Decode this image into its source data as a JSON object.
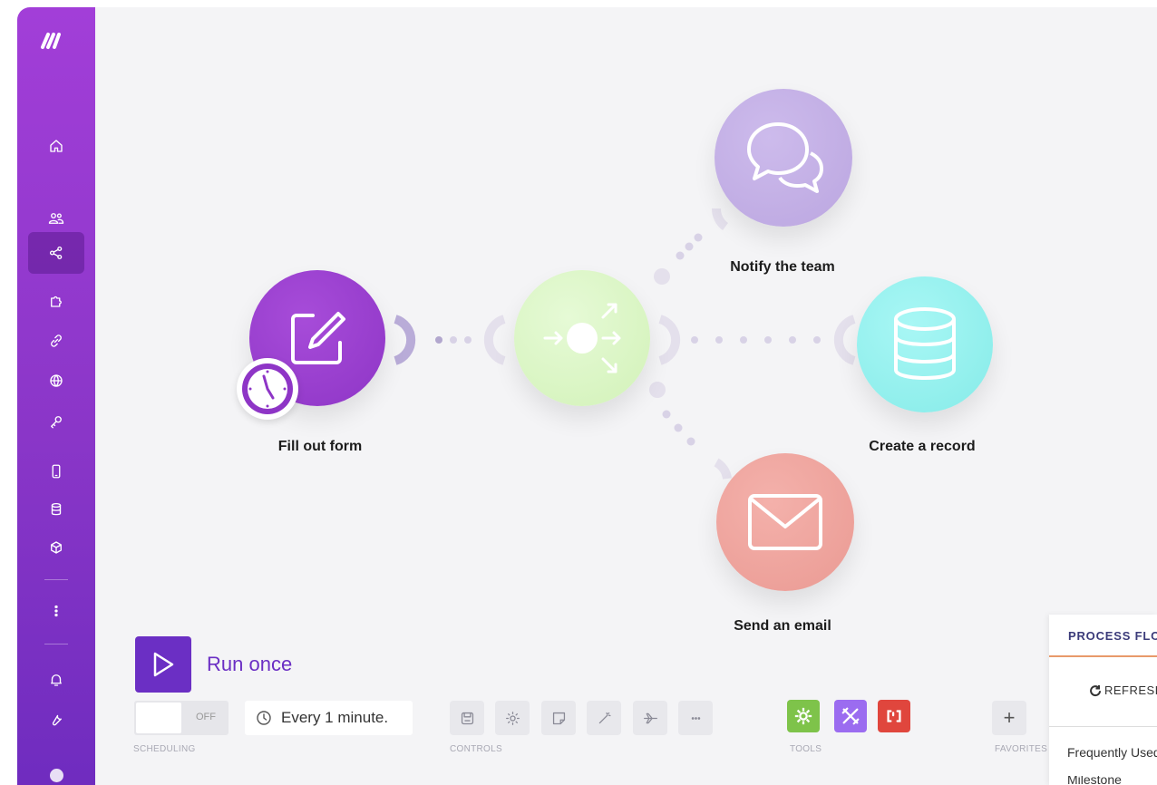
{
  "sidebar": {
    "logo_text": "M",
    "items": [
      {
        "name": "home",
        "icon": "home-icon"
      },
      {
        "name": "team",
        "icon": "users-icon"
      },
      {
        "name": "scenarios",
        "icon": "share-nodes-icon",
        "active": true
      },
      {
        "name": "templates",
        "icon": "puzzle-icon"
      },
      {
        "name": "connections",
        "icon": "link-icon"
      },
      {
        "name": "webhooks",
        "icon": "globe-icon"
      },
      {
        "name": "keys",
        "icon": "key-icon"
      },
      {
        "name": "devices",
        "icon": "mobile-icon"
      },
      {
        "name": "data-stores",
        "icon": "database-icon"
      },
      {
        "name": "data-structures",
        "icon": "cube-icon"
      },
      {
        "name": "more",
        "icon": "dots-vertical-icon"
      },
      {
        "name": "notifications",
        "icon": "bell-icon"
      },
      {
        "name": "settings",
        "icon": "wrench-icon"
      },
      {
        "name": "profile",
        "icon": "avatar-icon"
      }
    ]
  },
  "scenario": {
    "nodes": [
      {
        "id": "form",
        "label": "Fill out form",
        "color": "#9b3fd1",
        "icon": "edit-form-icon"
      },
      {
        "id": "router",
        "label": "",
        "color": "#dbf5c4",
        "icon": "router-icon"
      },
      {
        "id": "notify",
        "label": "Notify the team",
        "color": "#c6b3e6",
        "icon": "chat-bubbles-icon"
      },
      {
        "id": "record",
        "label": "Create a record",
        "color": "#8ef0ee",
        "icon": "database-icon"
      },
      {
        "id": "email",
        "label": "Send an email",
        "color": "#ef9e98",
        "icon": "envelope-icon"
      }
    ]
  },
  "bottom_bar": {
    "run_once": "Run once",
    "toggle_state": "OFF",
    "schedule": "Every 1 minute.",
    "scheduling_label": "SCHEDULING",
    "controls_label": "CONTROLS",
    "tools_label": "TOOLS",
    "favorites_label": "FAVORITES",
    "favorites_add": "+"
  },
  "panel": {
    "tab": "PROCESS FLOW",
    "refresh": "REFRESH",
    "frequent": "Frequently Used",
    "peek": "Milestone"
  },
  "colors": {
    "accent": "#6b2fc4",
    "sidebar": "#8a36c8",
    "tool_green": "#7ec34a",
    "tool_purple": "#9b6cf0",
    "tool_red": "#e0463d"
  }
}
